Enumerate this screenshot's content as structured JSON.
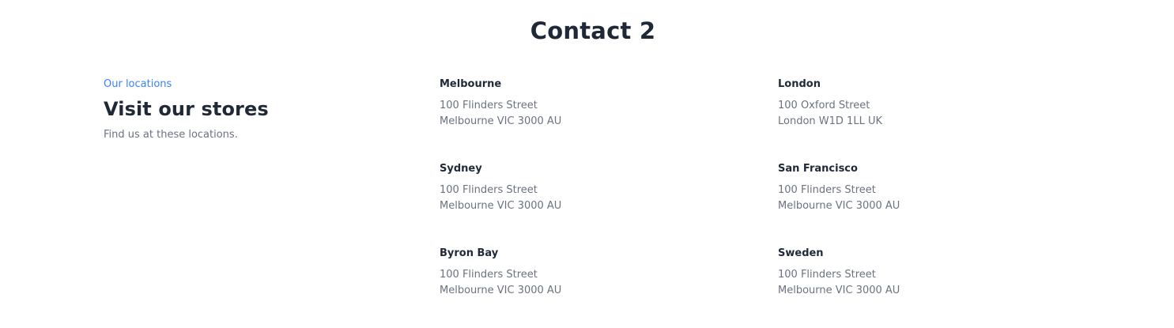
{
  "title": "Contact 2",
  "intro": {
    "eyebrow": "Our locations",
    "heading": "Visit our stores",
    "subtext": "Find us at these locations."
  },
  "locations": [
    {
      "name": "Melbourne",
      "line1": "100 Flinders Street",
      "line2": "Melbourne VIC 3000 AU"
    },
    {
      "name": "London",
      "line1": "100 Oxford Street",
      "line2": "London W1D 1LL UK"
    },
    {
      "name": "Sydney",
      "line1": "100 Flinders Street",
      "line2": "Melbourne VIC 3000 AU"
    },
    {
      "name": "San Francisco",
      "line1": "100 Flinders Street",
      "line2": "Melbourne VIC 3000 AU"
    },
    {
      "name": "Byron Bay",
      "line1": "100 Flinders Street",
      "line2": "Melbourne VIC 3000 AU"
    },
    {
      "name": "Sweden",
      "line1": "100 Flinders Street",
      "line2": "Melbourne VIC 3000 AU"
    }
  ],
  "colors": {
    "accent": "#3b82f6",
    "heading": "#1f2937",
    "muted": "#6b7280"
  }
}
